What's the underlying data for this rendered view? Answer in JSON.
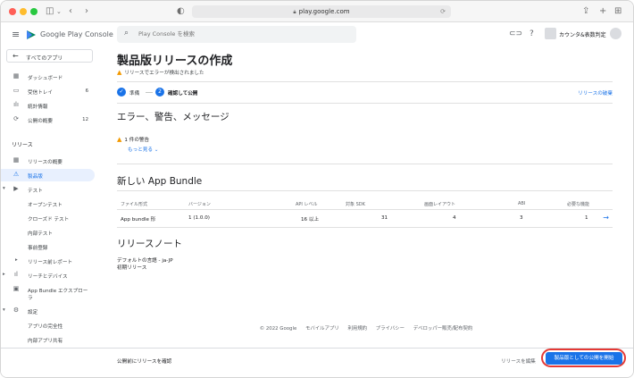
{
  "browser": {
    "url": "play.google.com"
  },
  "header": {
    "logo_text": "Google Play Console",
    "search_placeholder": "Play Console を検索",
    "developer_name": "カウンタ&表数判定"
  },
  "sidebar": {
    "back_label": "すべてのアプリ",
    "items": [
      {
        "label": "ダッシュボード",
        "icon": "dashboard-icon",
        "glyph": "▦"
      },
      {
        "label": "受信トレイ",
        "icon": "inbox-icon",
        "glyph": "▭",
        "count": "6"
      },
      {
        "label": "統計情報",
        "icon": "statistics-icon",
        "glyph": "▁▃▅"
      },
      {
        "label": "公開の概要",
        "icon": "publishing-icon",
        "glyph": "⟳",
        "count": "12"
      }
    ],
    "section_release": "リリース",
    "release_items": [
      {
        "label": "リリースの概要",
        "icon": "release-overview-icon",
        "glyph": "▦"
      },
      {
        "label": "製品版",
        "icon": "production-icon",
        "glyph": "⚠",
        "active": true
      },
      {
        "label": "テスト",
        "icon": "testing-icon",
        "glyph": "▶",
        "chevron": "▾"
      },
      {
        "label": "オープンテスト"
      },
      {
        "label": "クローズド テスト"
      },
      {
        "label": "内部テスト"
      },
      {
        "label": "事前登録"
      },
      {
        "label": "リリース前レポート",
        "chevron": "▸"
      },
      {
        "label": "リーチとデバイス",
        "icon": "reach-devices-icon",
        "glyph": "▁▃",
        "chevron": "▸"
      },
      {
        "label": "App Bundle エクスプロー",
        "label2": "ラ",
        "icon": "bundle-explorer-icon",
        "glyph": "▣"
      },
      {
        "label": "設定",
        "icon": "settings-icon",
        "glyph": "⚙",
        "chevron": "▾"
      },
      {
        "label": "アプリの完全性"
      },
      {
        "label": "内部アプリ共有"
      }
    ]
  },
  "main": {
    "title": "製品版リリースの作成",
    "error_text": "リリースでエラーが検出されました",
    "steps": [
      {
        "label": "準備",
        "mark": "✓"
      },
      {
        "label": "確認して公開",
        "mark": "2"
      }
    ],
    "discard_link": "リリースの破棄",
    "section_errors": "エラー、警告、メッセージ",
    "warning_count": "1 件の警告",
    "show_more": "もっと見る",
    "section_bundle": "新しい App Bundle",
    "table": {
      "headers": [
        "ファイル形式",
        "バージョン",
        "API レベル",
        "対象 SDK",
        "画面レイアウト",
        "ABI",
        "必要な機能"
      ],
      "rows": [
        [
          "App bundle 形",
          "1 (1.0.0)",
          "16 以上",
          "31",
          "4",
          "3",
          "1"
        ]
      ]
    },
    "section_notes": "リリースノート",
    "notes_lang": "デフォルトの言語 - ja-JP",
    "notes_text": "初期リリース"
  },
  "footer": {
    "items": [
      "© 2022 Google",
      "モバイルアプリ",
      "利用規約",
      "プライバシー",
      "デベロッパー販売/配布契約"
    ]
  },
  "action_bar": {
    "left_text": "公開前にリリースを確認",
    "edit_label": "リリースを編集",
    "primary_label": "製品版としての公開を開始"
  },
  "colors": {
    "accent": "#1a73e8",
    "warning": "#f29900",
    "highlight_ring": "#e53935"
  }
}
